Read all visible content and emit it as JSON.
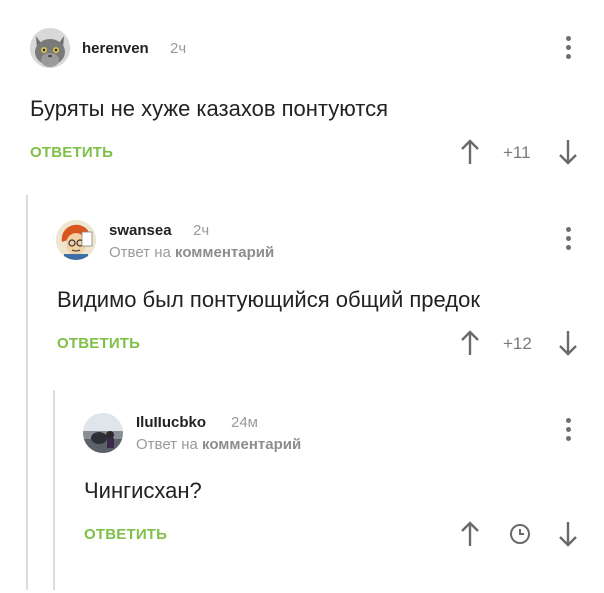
{
  "comments": [
    {
      "username": "herenven",
      "time": "2ч",
      "text": "Буряты не хуже казахов понтуются",
      "reply_label": "ОТВЕТИТЬ",
      "rating": "+11"
    },
    {
      "username": "swansea",
      "time": "2ч",
      "reply_prefix": "Ответ на",
      "reply_target": "комментарий",
      "text": "Видимо был понтующийся общий предок",
      "reply_label": "ОТВЕТИТЬ",
      "rating": "+12"
    },
    {
      "username": "IluIIucbko",
      "time": "24м",
      "reply_prefix": "Ответ на",
      "reply_target": "комментарий",
      "text": "Чингисхан?",
      "reply_label": "ОТВЕТИТЬ",
      "rating_status": "clock-icon"
    }
  ],
  "colors": {
    "accent_green": "#7ec048",
    "muted_gray": "#9a9a9a",
    "thread_line": "#dcdcdc"
  }
}
